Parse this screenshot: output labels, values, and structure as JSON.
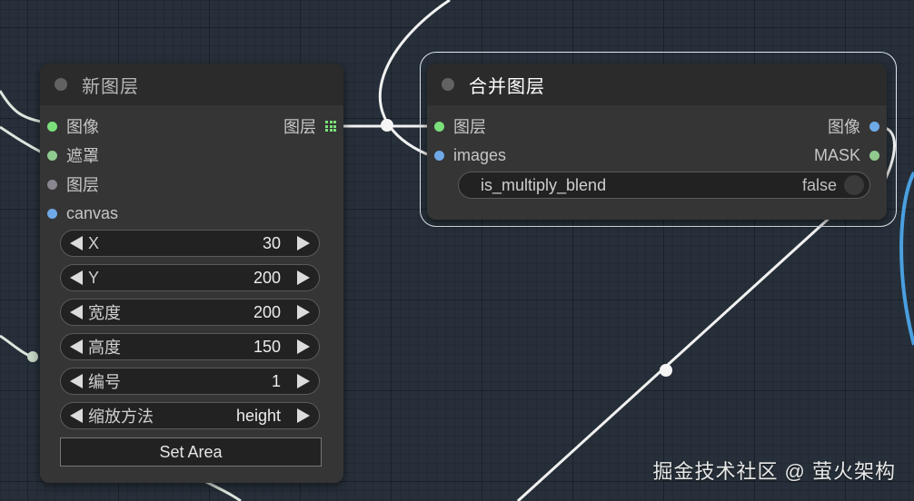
{
  "new_layer_node": {
    "title": "新图层",
    "inputs": [
      {
        "label": "图像",
        "color": "#7be07b"
      },
      {
        "label": "遮罩",
        "color": "#8fc98f"
      },
      {
        "label": "图层",
        "color": "#8a8690"
      },
      {
        "label": "canvas",
        "color": "#6fa9e8"
      }
    ],
    "output": {
      "label": "图层",
      "icon": "grid-icon",
      "color": "#7be07b"
    },
    "widgets": [
      {
        "label": "X",
        "value": "30"
      },
      {
        "label": "Y",
        "value": "200"
      },
      {
        "label": "宽度",
        "value": "200"
      },
      {
        "label": "高度",
        "value": "150"
      },
      {
        "label": "编号",
        "value": "1"
      },
      {
        "label": "缩放方法",
        "value": "height"
      }
    ],
    "set_area_label": "Set Area"
  },
  "merge_layer_node": {
    "title": "合并图层",
    "inputs": [
      {
        "label": "图层",
        "color": "#7be07b"
      },
      {
        "label": "images",
        "color": "#6fa9e8"
      }
    ],
    "outputs": [
      {
        "label": "图像",
        "color": "#6fa9e8"
      },
      {
        "label": "MASK",
        "color": "#8fc98f"
      }
    ],
    "toggle": {
      "label": "is_multiply_blend",
      "value": "false"
    }
  },
  "watermark": "掘金技术社区 @ 萤火架构"
}
